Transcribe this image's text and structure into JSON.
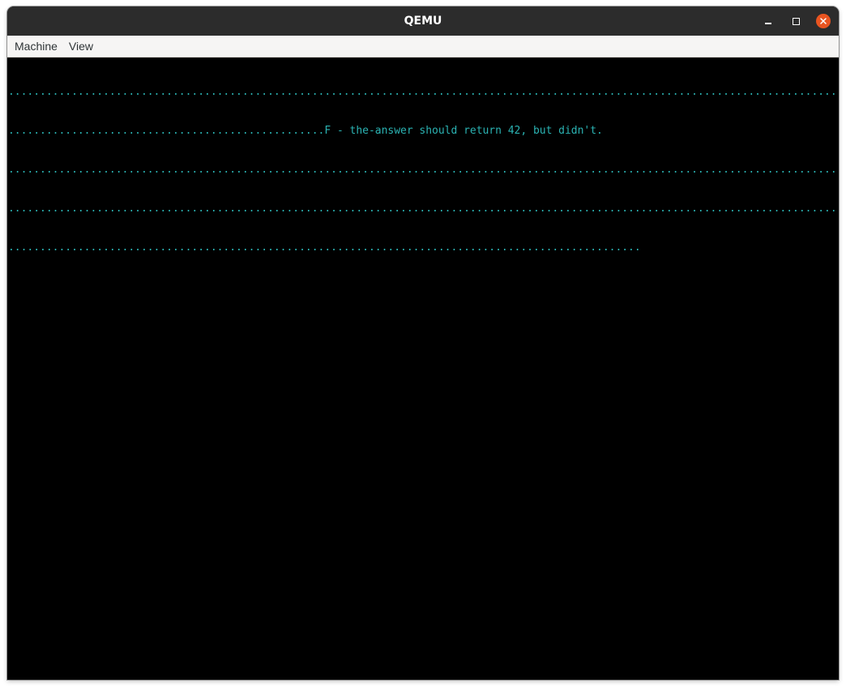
{
  "window": {
    "title": "QEMU",
    "controls": {
      "minimize_icon": "minimize-icon",
      "maximize_icon": "maximize-icon",
      "close_icon": "close-icon",
      "close_color": "#e95420"
    }
  },
  "menubar": {
    "items": [
      {
        "label": "Machine"
      },
      {
        "label": "View"
      }
    ]
  },
  "console": {
    "text_color": "#2bb3b3",
    "background": "#000000",
    "lines": [
      "...........................................................................................................................................................",
      "..................................................F - the-answer should return 42, but didn't.",
      "...........................................................................................................................................................",
      "...........................................................................................................................................................",
      "...................................................................................................."
    ]
  }
}
